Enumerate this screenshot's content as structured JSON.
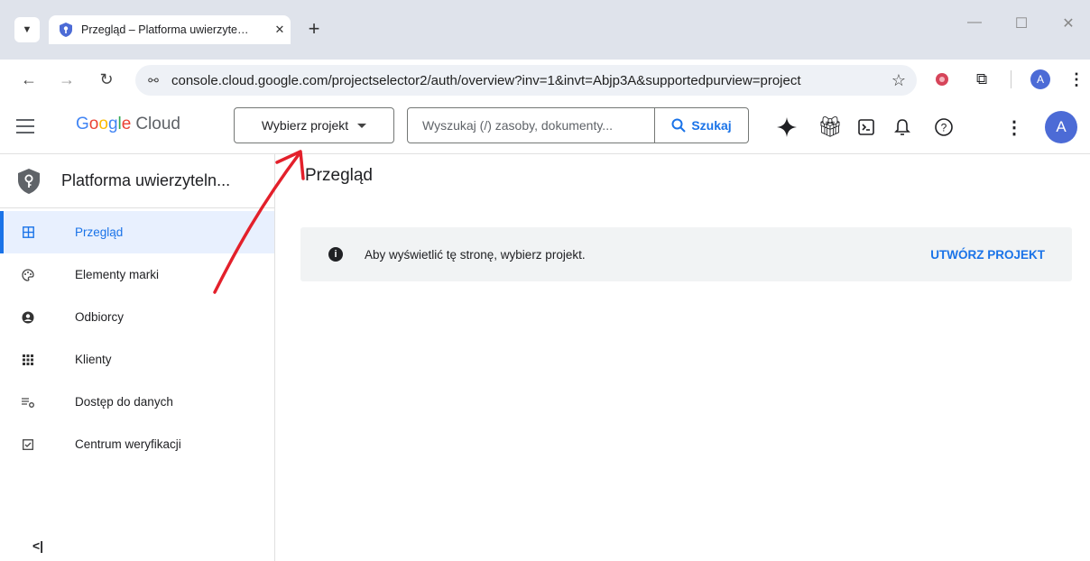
{
  "browser": {
    "tab_title": "Przegląd – Platforma uwierzyte…",
    "url": "console.cloud.google.com/projectselector2/auth/overview?inv=1&invt=Abjp3A&supportedpurview=project",
    "profile_initial": "A"
  },
  "header": {
    "logo_google": "Google",
    "logo_cloud": "Cloud",
    "project_button": "Wybierz projekt",
    "search_placeholder": "Wyszukaj (/) zasoby, dokumenty...",
    "search_button": "Szukaj",
    "avatar_initial": "A"
  },
  "sidebar": {
    "product_name": "Platforma uwierzyteln...",
    "items": [
      {
        "label": "Przegląd",
        "icon": "dashboard-icon",
        "active": true
      },
      {
        "label": "Elementy marki",
        "icon": "palette-icon",
        "active": false
      },
      {
        "label": "Odbiorcy",
        "icon": "account-circle-icon",
        "active": false
      },
      {
        "label": "Klienty",
        "icon": "apps-grid-icon",
        "active": false
      },
      {
        "label": "Dostęp do danych",
        "icon": "settings-list-icon",
        "active": false
      },
      {
        "label": "Centrum weryfikacji",
        "icon": "checkbox-icon",
        "active": false
      }
    ]
  },
  "main": {
    "title": "Przegląd",
    "banner_message": "Aby wyświetlić tę stronę, wybierz projekt.",
    "banner_action": "UTWÓRZ PROJEKT"
  },
  "colors": {
    "accent": "#1a73e8",
    "annotation_arrow": "#e3202b"
  }
}
